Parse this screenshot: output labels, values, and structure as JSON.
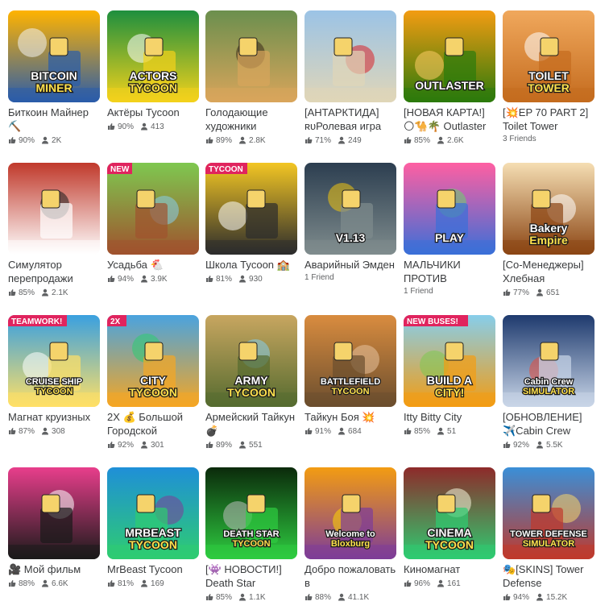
{
  "games": [
    {
      "title": "Биткоин Майнер ⛏️",
      "rating": "90%",
      "players": "2K",
      "palette": [
        "#ffb300",
        "#2a5caa",
        "#f2f2f2"
      ],
      "badge": "",
      "logo": "BITCOIN MINER"
    },
    {
      "title": "Актёры Tycoon",
      "rating": "90%",
      "players": "413",
      "palette": [
        "#1e8f3e",
        "#f4d21b",
        "#ffffff"
      ],
      "badge": "",
      "logo": "ACTORS TYCOON"
    },
    {
      "title": "Голодающие художники",
      "rating": "89%",
      "players": "2.8K",
      "palette": [
        "#6b8f4e",
        "#d9a55b",
        "#3b2a1a"
      ],
      "badge": "",
      "logo": ""
    },
    {
      "title": "[АНТАРКТИДА] ʀᴜРолевая игра",
      "rating": "71%",
      "players": "249",
      "palette": [
        "#9bc3e6",
        "#e0d6b8",
        "#d8232a"
      ],
      "badge": "",
      "logo": ""
    },
    {
      "title": "[НОВАЯ КАРТА!] 🌕🐪🌴 Outlaster",
      "rating": "85%",
      "players": "2.6K",
      "palette": [
        "#f39c12",
        "#2b7a0b",
        "#ffcc66"
      ],
      "badge": "",
      "logo": "OUTLASTER"
    },
    {
      "title": "[💥EP 70 PART 2] Toilet Tower",
      "rating": "",
      "players": "",
      "friends": "3 Friends",
      "palette": [
        "#f0a85c",
        "#c46b1e",
        "#ffffff"
      ],
      "badge": "",
      "logo": "TOILET TOWER"
    },
    {
      "title": "Симулятор перепродажи",
      "rating": "85%",
      "players": "2.1K",
      "palette": [
        "#c0392b",
        "#ffffff",
        "#1a1a1a"
      ],
      "badge": "",
      "logo": ""
    },
    {
      "title": "Усадьба 🐔",
      "rating": "94%",
      "players": "3.9K",
      "palette": [
        "#7ec850",
        "#a0522d",
        "#87ceeb"
      ],
      "badge": "NEW",
      "logo": ""
    },
    {
      "title": "Школа Tycoon 🏫",
      "rating": "81%",
      "players": "930",
      "palette": [
        "#f3c623",
        "#2c2c2c",
        "#ffffff"
      ],
      "badge": "TYCOON",
      "logo": ""
    },
    {
      "title": "Аварийный Эмден",
      "rating": "",
      "players": "",
      "friends": "1 Friend",
      "palette": [
        "#2c3e50",
        "#7f8c8d",
        "#f1c40f"
      ],
      "badge": "",
      "logo": "V1.13"
    },
    {
      "title": "МАЛЬЧИКИ ПРОТИВ",
      "rating": "",
      "players": "",
      "friends": "1 Friend",
      "palette": [
        "#ff5fa2",
        "#3a6fd8",
        "#6cd36c"
      ],
      "badge": "",
      "logo": "PLAY"
    },
    {
      "title": "[Со-Менеджеры] Хлебная",
      "rating": "77%",
      "players": "651",
      "palette": [
        "#f5deb3",
        "#8b4513",
        "#ffffff"
      ],
      "badge": "",
      "logo": "Bakery Empire"
    },
    {
      "title": "Магнат круизных",
      "rating": "87%",
      "players": "308",
      "palette": [
        "#3aa0e0",
        "#ffe066",
        "#ffffff"
      ],
      "badge": "TEAMWORK!",
      "logo": "CRUISE SHIP TYCOON"
    },
    {
      "title": "2X 💰 Большой Городской",
      "rating": "92%",
      "players": "301",
      "palette": [
        "#4aa3df",
        "#f5a623",
        "#2ecc71"
      ],
      "badge": "2X",
      "logo": "CITY TYCOON"
    },
    {
      "title": "Армейский Тайкун💣",
      "rating": "89%",
      "players": "551",
      "palette": [
        "#c8a660",
        "#556b2f",
        "#87ceeb"
      ],
      "badge": "",
      "logo": "ARMY TYCOON"
    },
    {
      "title": "Тайкун Боя 💥",
      "rating": "91%",
      "players": "684",
      "palette": [
        "#d98c3f",
        "#6b4e2e",
        "#e8c39e"
      ],
      "badge": "",
      "logo": "BATTLEFIELD TYCOON"
    },
    {
      "title": "Itty Bitty City",
      "rating": "85%",
      "players": "51",
      "palette": [
        "#87ceeb",
        "#f39c12",
        "#7ec850"
      ],
      "badge": "NEW BUSES!",
      "logo": "BUILD A CITY!"
    },
    {
      "title": "[ОБНОВЛЕНИЕ] ✈️Cabin Crew",
      "rating": "92%",
      "players": "5.5K",
      "palette": [
        "#1e3a6e",
        "#c9d6e8",
        "#e74c3c"
      ],
      "badge": "",
      "logo": "Cabin Crew SIMULATOR"
    },
    {
      "title": "🎥 Мой фильм",
      "rating": "88%",
      "players": "6.6K",
      "palette": [
        "#e83e8c",
        "#1a1a1a",
        "#ffffff"
      ],
      "badge": "",
      "logo": ""
    },
    {
      "title": "MrBeast Tycoon",
      "rating": "81%",
      "players": "169",
      "palette": [
        "#1f8fd8",
        "#2ecc71",
        "#7d3c98"
      ],
      "badge": "",
      "logo": "MRBEAST TYCOON"
    },
    {
      "title": "[👾 НОВОСТИ!] Death Star",
      "rating": "85%",
      "players": "1.1K",
      "palette": [
        "#0b2a0b",
        "#2ecc40",
        "#bdbdbd"
      ],
      "badge": "",
      "logo": "DEATH STAR TYCOON"
    },
    {
      "title": "Добро пожаловать в",
      "rating": "88%",
      "players": "41.1K",
      "palette": [
        "#f39c12",
        "#7d3c98",
        "#ffd700"
      ],
      "badge": "",
      "logo": "Welcome to Bloxburg"
    },
    {
      "title": "Киномагнат",
      "rating": "96%",
      "players": "161",
      "palette": [
        "#8e2a2a",
        "#2ecc71",
        "#f5f5dc"
      ],
      "badge": "",
      "logo": "CINEMA TYCOON"
    },
    {
      "title": "🎭[SKINS] Tower Defense",
      "rating": "94%",
      "players": "15.2K",
      "palette": [
        "#3a8fd8",
        "#c0392b",
        "#f5d76e"
      ],
      "badge": "",
      "logo": "TOWER DEFENSE SIMULATOR"
    }
  ],
  "icons": {
    "rating": "thumbs-up-icon",
    "players": "person-icon"
  },
  "colors": {
    "text": "#393b3d",
    "meta": "#606264",
    "background": "#ffffff"
  }
}
